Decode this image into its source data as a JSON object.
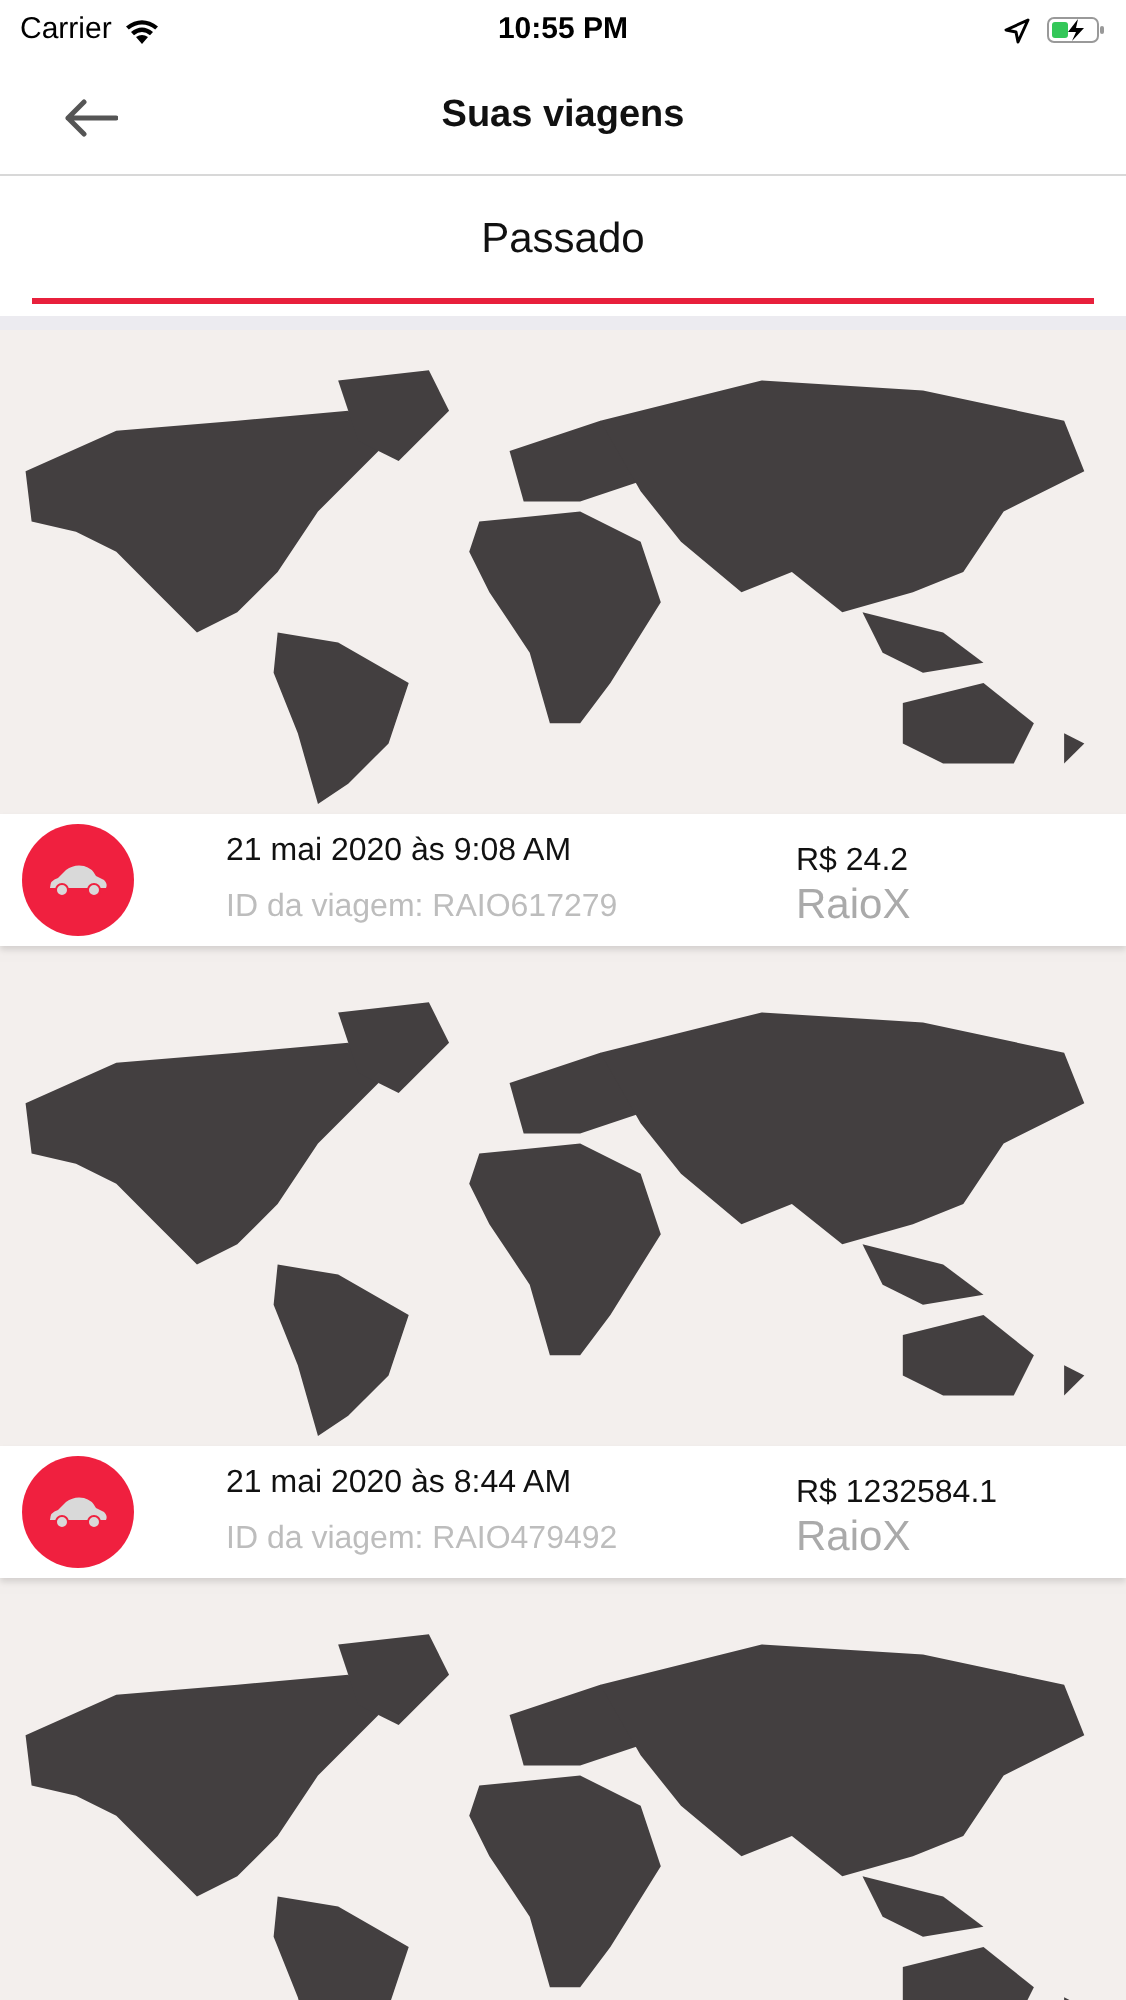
{
  "status_bar": {
    "carrier": "Carrier",
    "time": "10:55 PM"
  },
  "header": {
    "title": "Suas viagens"
  },
  "tabs": [
    {
      "label": "Passado",
      "selected": true
    }
  ],
  "trips": [
    {
      "kind": "full",
      "date": "21 mai 2020 às 9:08 AM",
      "trip_id": "ID da viagem: RAIO617279",
      "price": "R$ 24.2",
      "service": "RaioX"
    },
    {
      "kind": "full",
      "date": "21 mai 2020 às 8:44 AM",
      "trip_id": "ID da viagem: RAIO479492",
      "price": "R$ 1232584.1",
      "service": "RaioX"
    },
    {
      "kind": "map_only"
    }
  ]
}
